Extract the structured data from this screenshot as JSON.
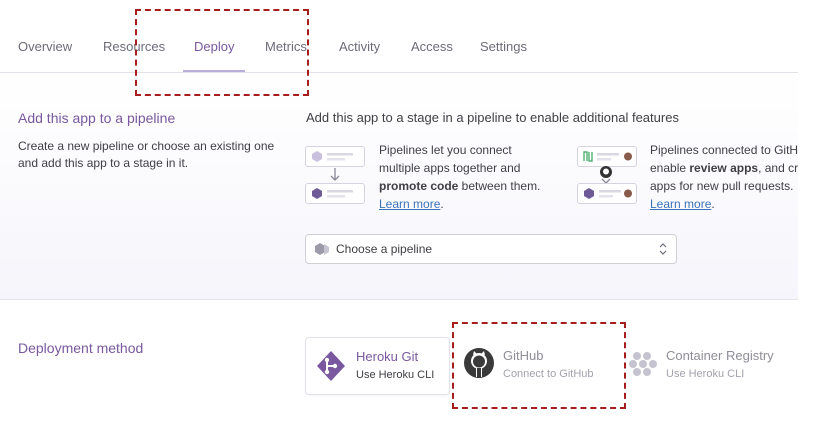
{
  "tabs": [
    {
      "label": "Overview"
    },
    {
      "label": "Resources"
    },
    {
      "label": "Deploy"
    },
    {
      "label": "Metrics"
    },
    {
      "label": "Activity"
    },
    {
      "label": "Access"
    },
    {
      "label": "Settings"
    }
  ],
  "active_tab": "Deploy",
  "pipeline": {
    "title": "Add this app to a pipeline",
    "description": "Create a new pipeline or choose an existing one and add this app to a stage in it.",
    "heading": "Add this app to a stage in a pipeline to enable additional features",
    "feature1": {
      "line1": "Pipelines let you connect",
      "line2": "multiple apps together and",
      "bold": "promote code",
      "line3_rest": " between them.",
      "link": "Learn more",
      "after_link": "."
    },
    "feature2": {
      "line1": "Pipelines connected to GitHub",
      "line2_pre": "enable ",
      "bold": "review apps",
      "line2_post": ", and create",
      "line3": "apps for new pull requests.",
      "link": "Learn more",
      "after_link": "."
    },
    "select_placeholder": "Choose a pipeline"
  },
  "deployment": {
    "title": "Deployment method",
    "methods": [
      {
        "title": "Heroku Git",
        "subtitle": "Use Heroku CLI",
        "icon": "heroku-git-icon"
      },
      {
        "title": "GitHub",
        "subtitle": "Connect to GitHub",
        "icon": "github-icon"
      },
      {
        "title": "Container Registry",
        "subtitle": "Use Heroku CLI",
        "icon": "container-registry-icon"
      }
    ]
  },
  "colors": {
    "accent": "#79589f",
    "link": "#3b73b9",
    "annotation": "#a51d1d"
  }
}
